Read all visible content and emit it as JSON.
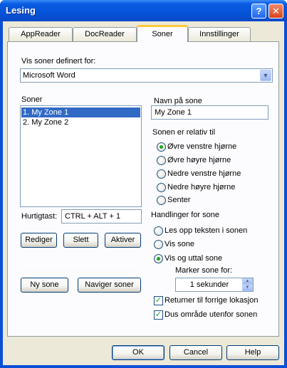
{
  "window": {
    "title": "Lesing",
    "help_btn": "?",
    "close_btn": "✕"
  },
  "tabs": [
    {
      "label": "AppReader",
      "active": false
    },
    {
      "label": "DocReader",
      "active": false
    },
    {
      "label": "Soner",
      "active": true
    },
    {
      "label": "Innstillinger",
      "active": false
    }
  ],
  "zones": {
    "show_for_label": "Vis soner definert for:",
    "show_for_value": "Microsoft Word",
    "list_label": "Soner",
    "list_items": [
      "1. My Zone 1",
      "2. My Zone 2"
    ],
    "selected_index": 0,
    "hotkey_label": "Hurtigtast:",
    "hotkey_value": "CTRL + ALT + 1",
    "edit_button": "Rediger",
    "delete_button": "Slett",
    "activate_button": "Aktiver",
    "new_button": "Ny sone",
    "navigate_button": "Naviger soner"
  },
  "zone_detail": {
    "name_label": "Navn på sone",
    "name_value": "My Zone 1",
    "relative_group": "Sonen er relativ til",
    "relative_options": [
      "Øvre venstre hjørne",
      "Øvre høyre hjørne",
      "Nedre venstre hjørne",
      "Nedre høyre hjørne",
      "Senter"
    ],
    "relative_selected": 0,
    "actions_group": "Handlinger for sone",
    "action_options": [
      "Les opp teksten i sonen",
      "Vis sone",
      "Vis og uttal sone"
    ],
    "action_selected": 2,
    "mark_label": "Marker sone for:",
    "mark_value": "1 sekunder",
    "return_checkbox": "Returner til forrige lokasjon",
    "return_checked": true,
    "dim_checkbox": "Dus område utenfor sonen",
    "dim_checked": true
  },
  "footer": {
    "ok": "OK",
    "cancel": "Cancel",
    "help": "Help"
  },
  "colors": {
    "titlebar": "#0553d8",
    "selection": "#316ac5",
    "radio_dot": "#21a121",
    "tab_highlight": "#ffc83c"
  }
}
